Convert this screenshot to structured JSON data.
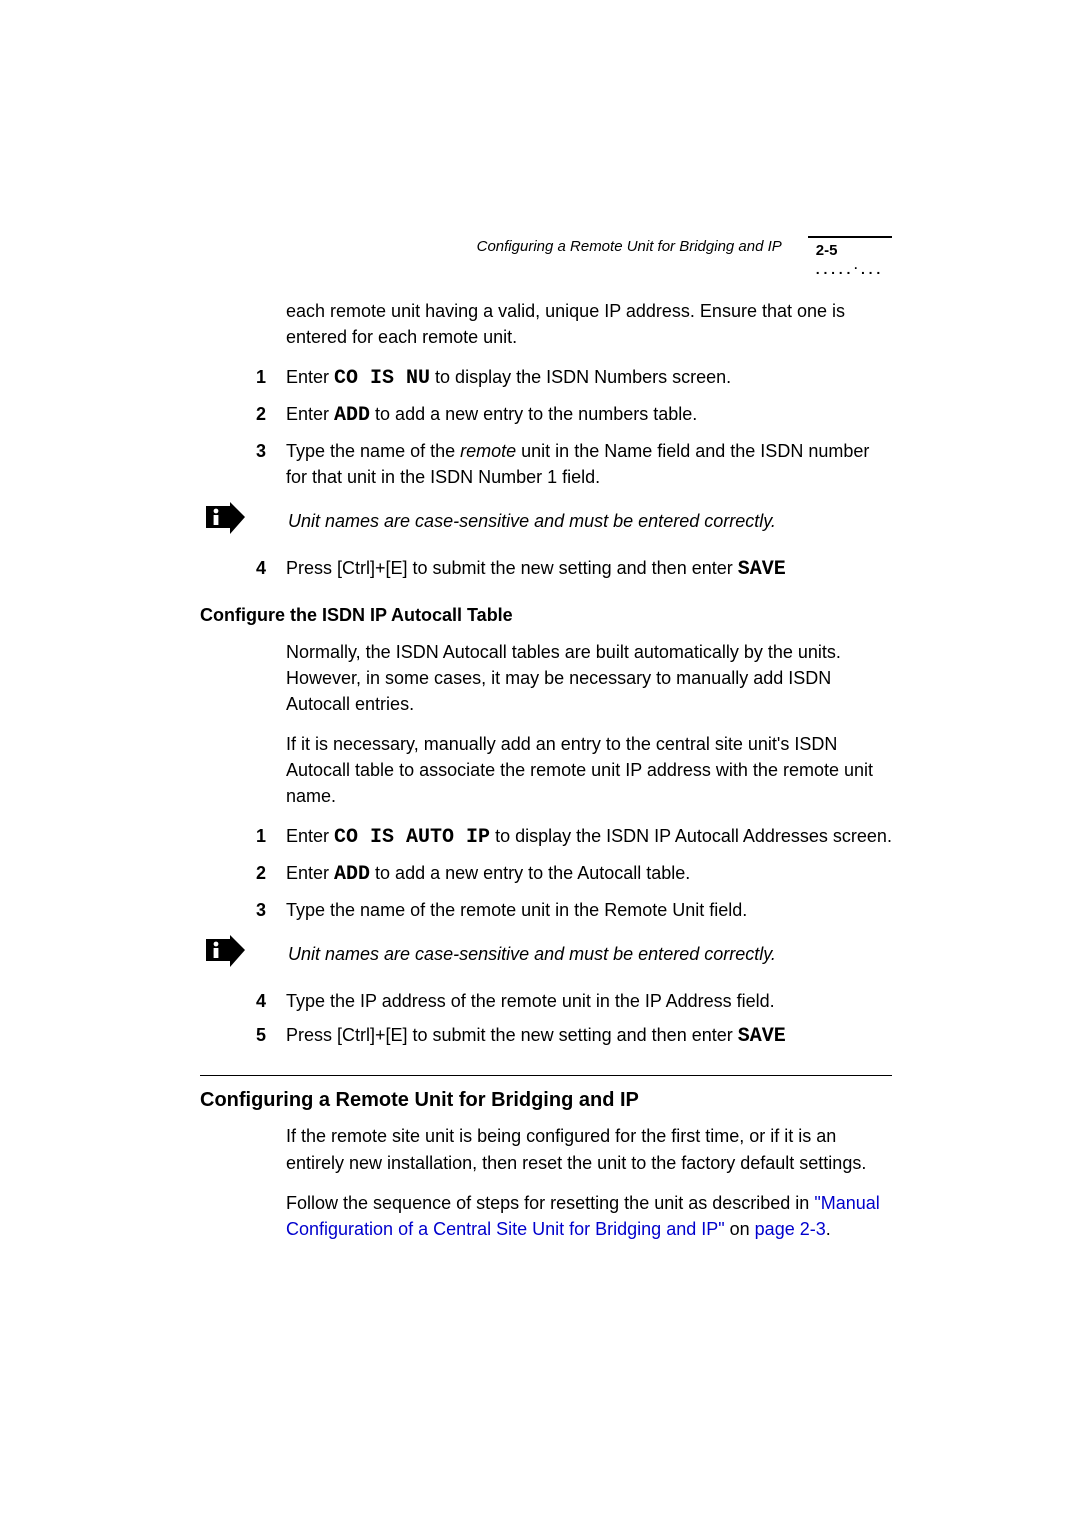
{
  "runningHead": {
    "title": "Configuring a Remote Unit for Bridging and IP",
    "pageNumber": "2-5"
  },
  "p_intro": "each remote unit having a valid, unique IP address. Ensure that one is entered for each remote unit.",
  "steps_a": {
    "n1": "1",
    "s1_a": "Enter ",
    "s1_code": "CO IS NU",
    "s1_b": " to display the ISDN Numbers screen.",
    "n2": "2",
    "s2_a": "Enter ",
    "s2_code": "ADD",
    "s2_b": " to add a new entry to the numbers table.",
    "n3": "3",
    "s3_a": "Type the name of the ",
    "s3_i": "remote",
    "s3_b": " unit in the Name field and the ISDN number for that unit in the ISDN Number 1 field."
  },
  "note1": "Unit names are case-sensitive and must be entered correctly.",
  "steps_a4": {
    "n4": "4",
    "s4_a": "Press [Ctrl]+[E] to submit the new setting and then enter ",
    "s4_code": "SAVE"
  },
  "h3_autocall": "Configure the ISDN IP Autocall Table",
  "p_autocall1": "Normally, the ISDN Autocall tables are built automatically by the units. However, in some cases, it may be necessary to manually add ISDN Autocall entries.",
  "p_autocall2": "If it is necessary, manually add an entry to the central site unit's ISDN Autocall table to associate the remote unit IP address with the remote unit name.",
  "steps_b": {
    "n1": "1",
    "s1_a": "Enter ",
    "s1_code": "CO IS AUTO IP",
    "s1_b": " to display the ISDN IP Autocall Addresses screen.",
    "n2": "2",
    "s2_a": "Enter ",
    "s2_code": "ADD",
    "s2_b": " to add a new entry to the Autocall table.",
    "n3": "3",
    "s3": "Type the name of the remote unit in the Remote Unit field."
  },
  "note2": "Unit names are case-sensitive and must be entered correctly.",
  "steps_b45": {
    "n4": "4",
    "s4": "Type the IP address of the remote unit in the IP Address field.",
    "n5": "5",
    "s5_a": "Press [Ctrl]+[E] to submit the new setting and then enter ",
    "s5_code": "SAVE"
  },
  "h2_remote": "Configuring a Remote Unit for Bridging and IP",
  "p_remote1": "If the remote site unit is being configured for the first time, or if it is an entirely new installation, then reset the unit to the factory default settings.",
  "p_remote2_a": "Follow the sequence of steps for resetting the unit as described in ",
  "p_remote2_link1": "\"Manual Configuration of a Central Site Unit for Bridging and IP\"",
  "p_remote2_b": " on ",
  "p_remote2_link2": "page 2-3",
  "p_remote2_c": "."
}
